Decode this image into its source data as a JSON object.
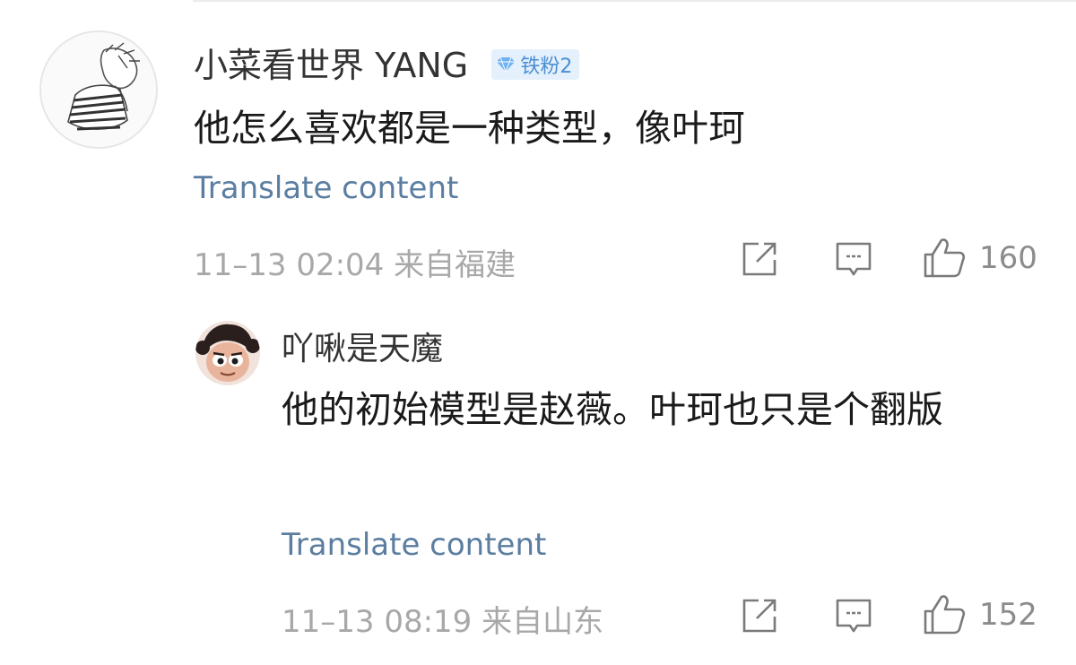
{
  "comments": [
    {
      "username": "小菜看世界 YANG",
      "badge": "铁粉2",
      "text": "他怎么喜欢都是一种类型，像叶珂",
      "translate": "Translate content",
      "date": "11–13 02:04",
      "location": "来自福建",
      "likes": "160"
    },
    {
      "username": "吖啾是天魔",
      "text": "他的初始模型是赵薇。叶珂也只是个翻版",
      "translate": "Translate content",
      "date": "11–13 08:19",
      "location": "来自山东",
      "likes": "152"
    }
  ],
  "icons": {
    "share": "share-icon",
    "reply": "comment-icon",
    "like": "thumbs-up-icon",
    "badge_gem": "diamond-icon"
  },
  "colors": {
    "link": "#5b7ea0",
    "meta": "#a8a8a8",
    "badge_bg": "#e4f0fb",
    "badge_fg": "#4a8fd4"
  }
}
